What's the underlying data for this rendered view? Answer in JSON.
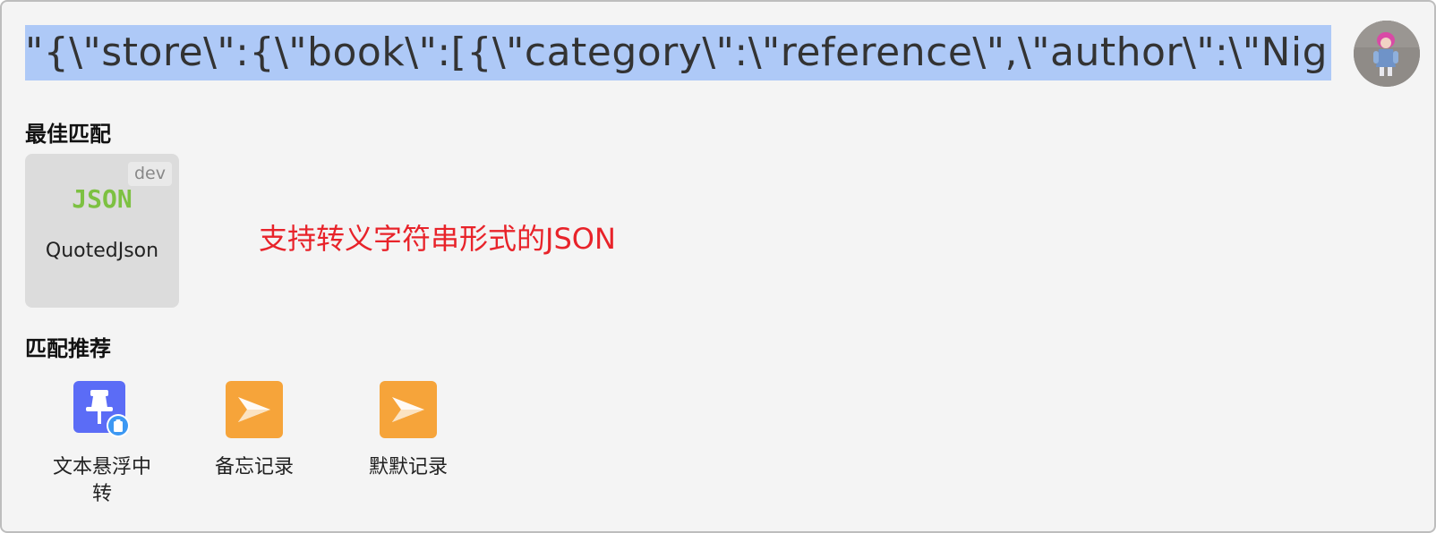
{
  "search": {
    "query": "\"{\\\"store\\\":{\\\"book\\\":[{\\\"category\\\":\\\"reference\\\",\\\"author\\\":\\\"Nig"
  },
  "sections": {
    "best_match_title": "最佳匹配",
    "recommend_title": "匹配推荐"
  },
  "best_match": {
    "badge": "dev",
    "logo_text": "JSON",
    "label": "QuotedJson"
  },
  "annotation": "支持转义字符串形式的JSON",
  "recommendations": [
    {
      "label": "文本悬浮中转",
      "icon": "pin-clipboard-icon"
    },
    {
      "label": "备忘记录",
      "icon": "memo-star-icon"
    },
    {
      "label": "默默记录",
      "icon": "memo-star-icon"
    }
  ],
  "colors": {
    "selection": "#aec9f7",
    "annotation": "#e8232a",
    "json_logo": "#7dc142",
    "pin_icon_bg": "#5b6cf6",
    "memo_icon_bg": "#f6a43a"
  }
}
